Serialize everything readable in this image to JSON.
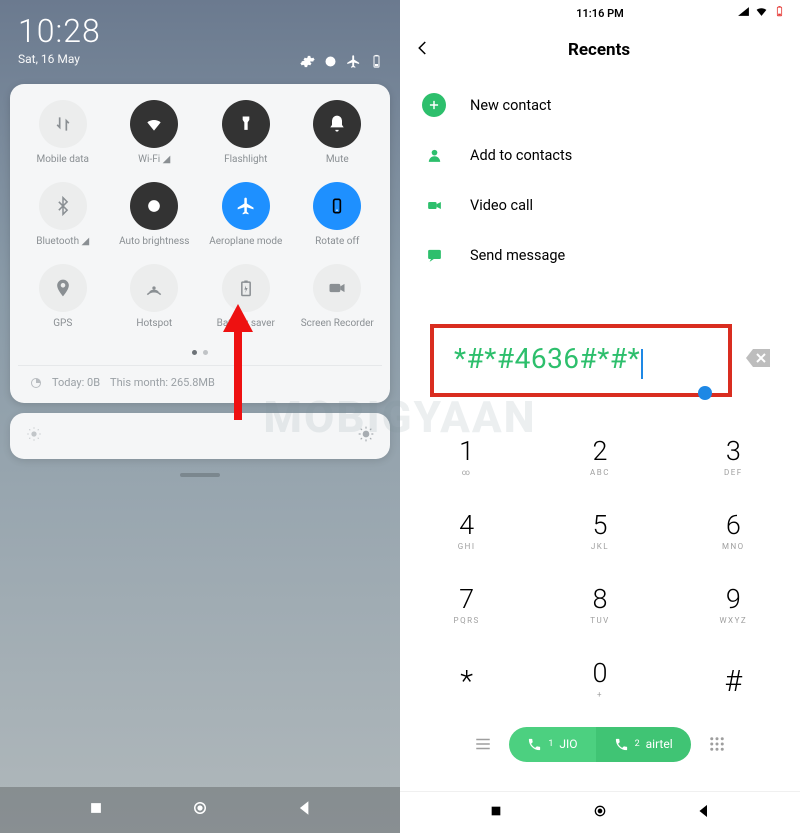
{
  "watermark": "MOBIGYAAN",
  "left": {
    "clock": "10:28",
    "date": "Sat, 16 May",
    "qs": [
      {
        "label": "Mobile data",
        "icon": "mobile-data",
        "state": "off"
      },
      {
        "label": "Wi-Fi ◢",
        "icon": "wifi",
        "state": "dark"
      },
      {
        "label": "Flashlight",
        "icon": "flashlight",
        "state": "dark"
      },
      {
        "label": "Mute",
        "icon": "mute",
        "state": "dark"
      },
      {
        "label": "Bluetooth ◢",
        "icon": "bluetooth",
        "state": "off"
      },
      {
        "label": "Auto brightness",
        "icon": "auto-bright",
        "state": "dark"
      },
      {
        "label": "Aeroplane mode",
        "icon": "airplane",
        "state": "on"
      },
      {
        "label": "Rotate off",
        "icon": "rotate",
        "state": "on"
      },
      {
        "label": "GPS",
        "icon": "gps",
        "state": "off"
      },
      {
        "label": "Hotspot",
        "icon": "hotspot",
        "state": "off"
      },
      {
        "label": "Battery saver",
        "icon": "battery",
        "state": "off"
      },
      {
        "label": "Screen Recorder",
        "icon": "recorder",
        "state": "off"
      }
    ],
    "usage_today_label": "Today: 0B",
    "usage_month_label": "This month: 265.8MB"
  },
  "right": {
    "status_time": "11:16 PM",
    "header_title": "Recents",
    "actions": [
      {
        "label": "New contact",
        "icon": "plus",
        "plus": true
      },
      {
        "label": "Add to contacts",
        "icon": "person"
      },
      {
        "label": "Video call",
        "icon": "video"
      },
      {
        "label": "Send message",
        "icon": "message"
      }
    ],
    "dialed_number": "*#*#4636#*#*",
    "keys": [
      {
        "num": "1",
        "sub": "∞"
      },
      {
        "num": "2",
        "sub": "ABC"
      },
      {
        "num": "3",
        "sub": "DEF"
      },
      {
        "num": "4",
        "sub": "GHI"
      },
      {
        "num": "5",
        "sub": "JKL"
      },
      {
        "num": "6",
        "sub": "MNO"
      },
      {
        "num": "7",
        "sub": "PQRS"
      },
      {
        "num": "8",
        "sub": "TUV"
      },
      {
        "num": "9",
        "sub": "WXYZ"
      },
      {
        "num": "*",
        "sub": ""
      },
      {
        "num": "0",
        "sub": "+"
      },
      {
        "num": "#",
        "sub": ""
      }
    ],
    "sim1": {
      "idx": "1",
      "name": "JIO"
    },
    "sim2": {
      "idx": "2",
      "name": "airtel"
    }
  }
}
